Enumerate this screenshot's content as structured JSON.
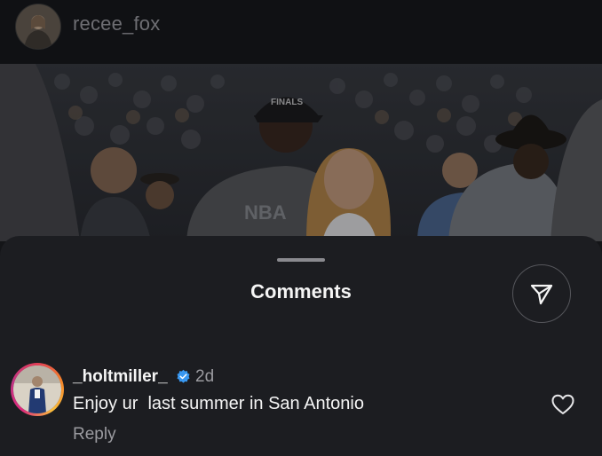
{
  "post": {
    "username": "recee_fox",
    "avatar_icon": "profile-avatar",
    "photo_description_icon": "post-photo",
    "shirt_text": "NBA Finals",
    "cap_text": "FINALS"
  },
  "comments_sheet": {
    "title": "Comments",
    "share_icon": "send-icon"
  },
  "comments": [
    {
      "username": "_holtmiller_",
      "verified": true,
      "time": "2d",
      "text": "Enjoy ur  last summer in San Antonio",
      "reply_label": "Reply",
      "like_icon": "heart-icon"
    }
  ],
  "colors": {
    "background": "#141518",
    "sheet": "#1c1d21",
    "verified_badge": "#3897f0",
    "muted_text": "#9b9ba0"
  }
}
